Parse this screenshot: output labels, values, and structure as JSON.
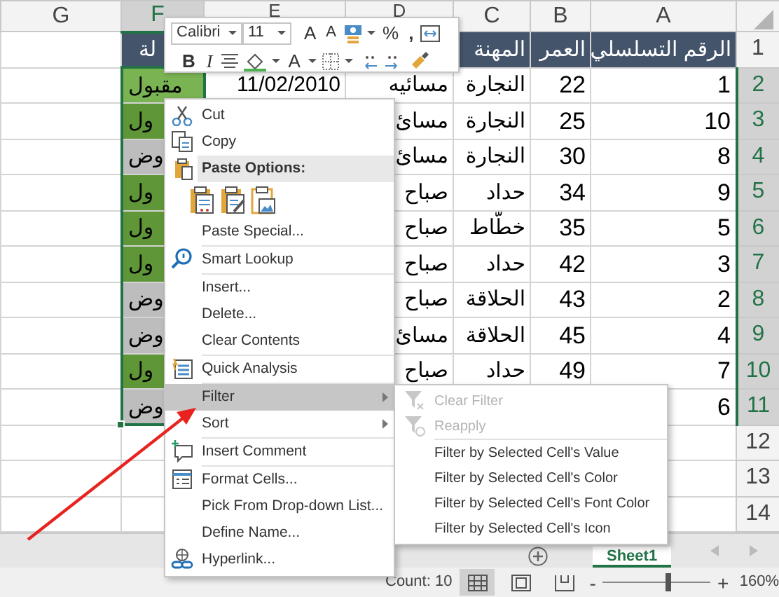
{
  "sheet": {
    "columns": [
      {
        "label": "A",
        "selected": false
      },
      {
        "label": "B",
        "selected": false
      },
      {
        "label": "C",
        "selected": false
      },
      {
        "label": "D",
        "selected": false
      },
      {
        "label": "E",
        "selected": false
      },
      {
        "label": "F",
        "selected": true
      },
      {
        "label": "G",
        "selected": false
      }
    ],
    "rows": [
      {
        "number": "1",
        "selected": false,
        "header": true,
        "cells": [
          {
            "text": "الرقم التسلسلي"
          },
          {
            "text": "العمر"
          },
          {
            "text": "المهنة"
          },
          null,
          null,
          {
            "text": "لة"
          },
          null
        ]
      },
      {
        "number": "2",
        "selected": true,
        "header": false,
        "cells": [
          {
            "text": "1"
          },
          {
            "text": "22"
          },
          {
            "text": "النجارة"
          },
          {
            "text": "مسائيه"
          },
          {
            "text": "11/02/2010"
          },
          {
            "text": "مقبول",
            "color": "#7ab352"
          },
          null
        ]
      },
      {
        "number": "3",
        "selected": true,
        "header": false,
        "cells": [
          {
            "text": "10"
          },
          {
            "text": "25"
          },
          {
            "text": "النجارة"
          },
          {
            "text": "مسائ"
          },
          null,
          {
            "text": "ول",
            "color": "#5f9637"
          },
          null
        ]
      },
      {
        "number": "4",
        "selected": true,
        "header": false,
        "cells": [
          {
            "text": "8"
          },
          {
            "text": "30"
          },
          {
            "text": "النجارة"
          },
          {
            "text": "مسائ"
          },
          null,
          {
            "text": "وض",
            "color": "#bdbdbd"
          },
          null
        ]
      },
      {
        "number": "5",
        "selected": true,
        "header": false,
        "cells": [
          {
            "text": "9"
          },
          {
            "text": "34"
          },
          {
            "text": "حداد"
          },
          {
            "text": "صباح"
          },
          null,
          {
            "text": "ول",
            "color": "#5f9637"
          },
          null
        ]
      },
      {
        "number": "6",
        "selected": true,
        "header": false,
        "cells": [
          {
            "text": "5"
          },
          {
            "text": "35"
          },
          {
            "text": "خطّاط"
          },
          {
            "text": "صباح"
          },
          null,
          {
            "text": "ول",
            "color": "#5f9637"
          },
          null
        ]
      },
      {
        "number": "7",
        "selected": true,
        "header": false,
        "cells": [
          {
            "text": "3"
          },
          {
            "text": "42"
          },
          {
            "text": "حداد"
          },
          {
            "text": "صباح"
          },
          null,
          {
            "text": "ول",
            "color": "#5f9637"
          },
          null
        ]
      },
      {
        "number": "8",
        "selected": true,
        "header": false,
        "cells": [
          {
            "text": "2"
          },
          {
            "text": "43"
          },
          {
            "text": "الحلاقة"
          },
          {
            "text": "صباح"
          },
          null,
          {
            "text": "وض",
            "color": "#bdbdbd"
          },
          null
        ]
      },
      {
        "number": "9",
        "selected": true,
        "header": false,
        "cells": [
          {
            "text": "4"
          },
          {
            "text": "45"
          },
          {
            "text": "الحلاقة"
          },
          {
            "text": "مسائ"
          },
          null,
          {
            "text": "وض",
            "color": "#bdbdbd"
          },
          null
        ]
      },
      {
        "number": "10",
        "selected": true,
        "header": false,
        "cells": [
          {
            "text": "7"
          },
          {
            "text": "49"
          },
          {
            "text": "حداد"
          },
          {
            "text": "صباح"
          },
          null,
          {
            "text": "ول",
            "color": "#5f9637"
          },
          null
        ]
      },
      {
        "number": "11",
        "selected": true,
        "header": false,
        "cells": [
          {
            "text": "6"
          },
          null,
          null,
          null,
          null,
          {
            "text": "وض",
            "color": "#bdbdbd"
          },
          null
        ]
      },
      {
        "number": "12",
        "selected": false,
        "header": false,
        "cells": [
          null,
          null,
          null,
          null,
          null,
          null,
          null
        ]
      },
      {
        "number": "13",
        "selected": false,
        "header": false,
        "cells": [
          null,
          null,
          null,
          null,
          null,
          null,
          null
        ]
      },
      {
        "number": "14",
        "selected": false,
        "header": false,
        "cells": [
          null,
          null,
          null,
          null,
          null,
          null,
          null
        ]
      }
    ]
  },
  "mini_toolbar": {
    "font": "Calibri",
    "size": "11",
    "grow_font": "A",
    "shrink_font": "A",
    "percent": "%",
    "comma": ",",
    "bold": "B",
    "italic": "I",
    "font_color": "A"
  },
  "context_menu": [
    {
      "kind": "item",
      "label": "Cut",
      "selected": false,
      "has_submenu": false
    },
    {
      "kind": "item",
      "label": "Copy",
      "selected": false,
      "has_submenu": false
    },
    {
      "kind": "header",
      "label": "Paste Options:"
    },
    {
      "kind": "paste-icons"
    },
    {
      "kind": "item",
      "label": "Paste Special...",
      "selected": false,
      "has_submenu": false
    },
    {
      "kind": "separator"
    },
    {
      "kind": "item",
      "label": "Smart Lookup",
      "selected": false,
      "has_submenu": false
    },
    {
      "kind": "separator"
    },
    {
      "kind": "item",
      "label": "Insert...",
      "selected": false,
      "has_submenu": false
    },
    {
      "kind": "item",
      "label": "Delete...",
      "selected": false,
      "has_submenu": false
    },
    {
      "kind": "item",
      "label": "Clear Contents",
      "selected": false,
      "has_submenu": false
    },
    {
      "kind": "separator"
    },
    {
      "kind": "item",
      "label": "Quick Analysis",
      "selected": false,
      "has_submenu": false
    },
    {
      "kind": "separator"
    },
    {
      "kind": "item",
      "label": "Filter",
      "selected": true,
      "has_submenu": true
    },
    {
      "kind": "item",
      "label": "Sort",
      "selected": false,
      "has_submenu": true
    },
    {
      "kind": "separator"
    },
    {
      "kind": "item",
      "label": "Insert Comment",
      "selected": false,
      "has_submenu": false
    },
    {
      "kind": "separator"
    },
    {
      "kind": "item",
      "label": "Format Cells...",
      "selected": false,
      "has_submenu": false
    },
    {
      "kind": "item",
      "label": "Pick From Drop-down List...",
      "selected": false,
      "has_submenu": false
    },
    {
      "kind": "item",
      "label": "Define Name...",
      "selected": false,
      "has_submenu": false
    },
    {
      "kind": "item",
      "label": "Hyperlink...",
      "selected": false,
      "has_submenu": false
    }
  ],
  "filter_submenu": [
    {
      "kind": "item",
      "label": "Clear Filter",
      "disabled": true
    },
    {
      "kind": "item",
      "label": "Reapply",
      "disabled": true
    },
    {
      "kind": "separator"
    },
    {
      "kind": "item",
      "label": "Filter by Selected Cell's Value",
      "disabled": false
    },
    {
      "kind": "item",
      "label": "Filter by Selected Cell's Color",
      "disabled": false
    },
    {
      "kind": "item",
      "label": "Filter by Selected Cell's Font Color",
      "disabled": false
    },
    {
      "kind": "item",
      "label": "Filter by Selected Cell's Icon",
      "disabled": false
    }
  ],
  "sheet_tabs": [
    {
      "label": "Sheet1",
      "selected": true
    }
  ],
  "status_bar": {
    "text": "Count: 10",
    "views": [
      {
        "selected": true
      },
      {
        "selected": false
      },
      {
        "selected": false
      }
    ],
    "zoom": {
      "minus": "-",
      "plus": "+",
      "level": 0.58,
      "value": "160%"
    }
  }
}
